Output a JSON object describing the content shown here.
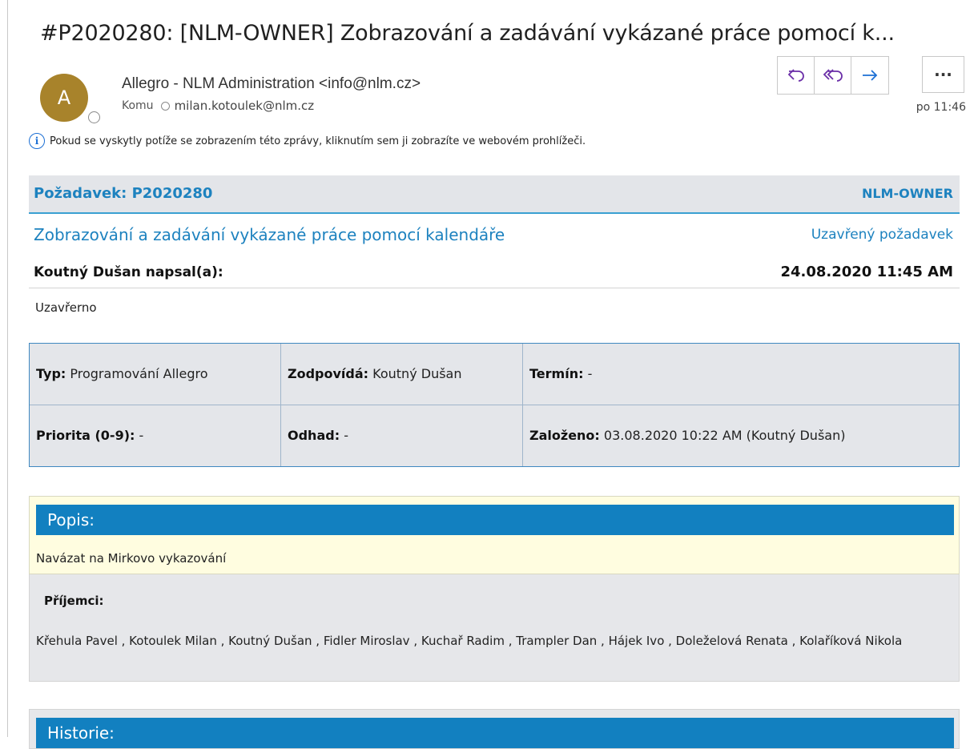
{
  "email": {
    "subject": "#P2020280: [NLM-OWNER] Zobrazování a zadávání vykázané práce pomocí k...",
    "avatar_letter": "A",
    "avatar_color": "#a8832b",
    "sender": "Allegro - NLM Administration <info@nlm.cz>",
    "to_label": "Komu",
    "to_address": "milan.kotoulek@nlm.cz",
    "time": "po 11:46",
    "info_text": "Pokud se vyskytly potíže se zobrazením této zprávy, kliknutím sem ji zobrazíte ve webovém prohlížeči.",
    "actions": {
      "reply_icon": "⤺",
      "reply_all_icon": "⟪",
      "forward_icon": "→",
      "more_icon": "···"
    }
  },
  "request": {
    "label": "Požadavek: P2020280",
    "owner": "NLM-OWNER",
    "title": "Zobrazování a zadávání vykázané práce pomocí kalendáře",
    "state": "Uzavřený požadavek",
    "author": "Koutný Dušan napsal(a):",
    "datetime": "24.08.2020 11:45 AM",
    "status_text": "Uzavřerno"
  },
  "meta": {
    "typ_label": "Typ:",
    "typ_value": "Programování Allegro",
    "zodpovida_label": "Zodpovídá:",
    "zodpovida_value": "Koutný Dušan",
    "termin_label": "Termín:",
    "termin_value": "-",
    "priorita_label": "Priorita (0-9):",
    "priorita_value": "-",
    "odhad_label": "Odhad:",
    "odhad_value": "-",
    "zalozeno_label": "Založeno:",
    "zalozeno_value": "03.08.2020 10:22 AM (Koutný Dušan)"
  },
  "popis": {
    "heading": "Popis:",
    "text": "Navázat na Mirkovo vykazování"
  },
  "recipients": {
    "heading": "Příjemci:",
    "list": "Křehula Pavel , Kotoulek Milan , Koutný Dušan , Fidler Miroslav , Kuchař Radim , Trampler Dan , Hájek Ivo , Doleželová Renata , Kolaříková Nikola"
  },
  "history": {
    "heading": "Historie:"
  },
  "colors": {
    "accent_blue": "#1d82bf",
    "section_bar": "#1280c0",
    "action_purple": "#6b2fa8"
  }
}
